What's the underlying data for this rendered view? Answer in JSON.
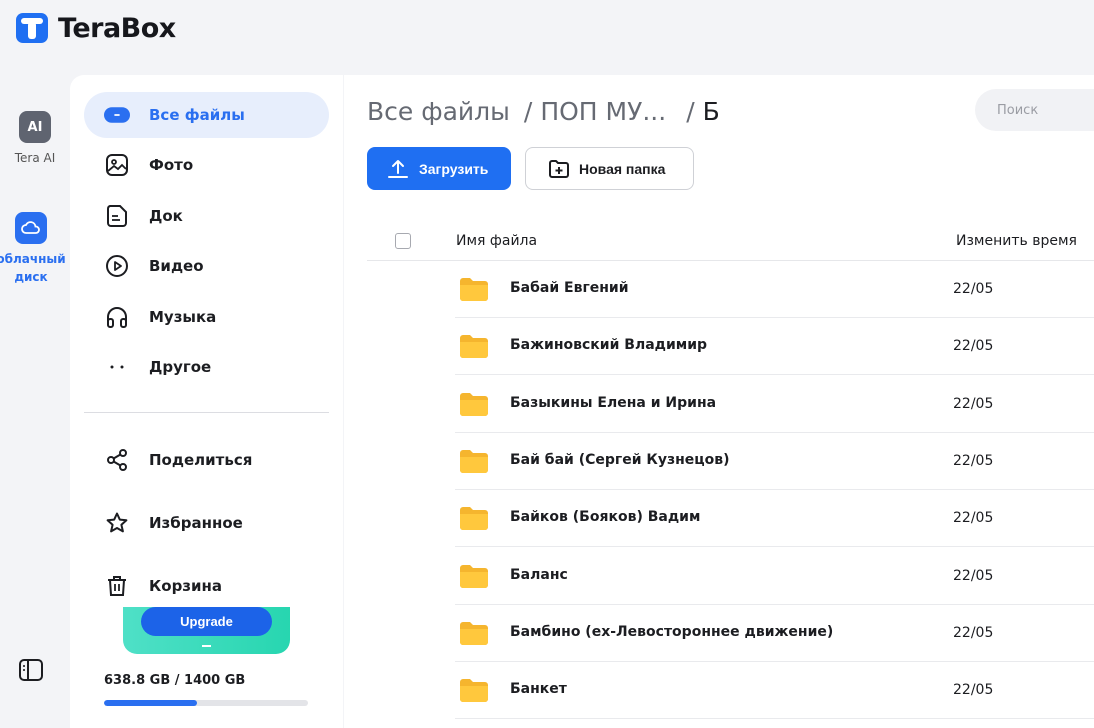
{
  "app": {
    "logo_text": "TeraBox"
  },
  "rail": {
    "items": [
      {
        "label": "Tera AI",
        "icon": "tera-ai-icon"
      },
      {
        "label_line1": "облачный",
        "label_line2": "диск",
        "icon": "cloud-drive-icon"
      }
    ]
  },
  "sidebar": {
    "nav": [
      {
        "label": "Все файлы",
        "icon": "all-files-icon"
      },
      {
        "label": "Фото",
        "icon": "photo-icon"
      },
      {
        "label": "Док",
        "icon": "document-icon"
      },
      {
        "label": "Видео",
        "icon": "video-icon"
      },
      {
        "label": "Музыка",
        "icon": "headphones-icon"
      },
      {
        "label": "Другое",
        "icon": "more-icon"
      }
    ],
    "tools": [
      {
        "label": "Поделиться",
        "icon": "share-icon"
      },
      {
        "label": "Избранное",
        "icon": "star-icon"
      },
      {
        "label": "Корзина",
        "icon": "trash-icon"
      }
    ],
    "upgrade_label": "Upgrade",
    "storage_text": "638.8 GB / 1400 GB",
    "storage_used_fraction": 0.456
  },
  "main": {
    "breadcrumb": {
      "root": "Все файлы",
      "sep1": "/",
      "middle": "ПОП МУ...",
      "sep2": "/",
      "current": "Б"
    },
    "search_placeholder": "Поиск",
    "upload_label": "Загрузить",
    "new_folder_label": "Новая папка",
    "columns": {
      "name": "Имя файла",
      "time": "Изменить время"
    },
    "rows": [
      {
        "name": "Бабай Евгений",
        "date": "22/05"
      },
      {
        "name": "Бажиновский Владимир",
        "date": "22/05"
      },
      {
        "name": "Базыкины Елена и Ирина",
        "date": "22/05"
      },
      {
        "name": "Бай бай (Сергей Кузнецов)",
        "date": "22/05"
      },
      {
        "name": "Байков (Бояков) Вадим",
        "date": "22/05"
      },
      {
        "name": "Баланс",
        "date": "22/05"
      },
      {
        "name": "Бамбино (ex-Левостороннее движение)",
        "date": "22/05"
      },
      {
        "name": "Банкет",
        "date": "22/05"
      }
    ]
  },
  "colors": {
    "accent": "#2a6ff0",
    "folder": "#ffc83d",
    "upgrade_gradient": "#2fd9b6"
  }
}
